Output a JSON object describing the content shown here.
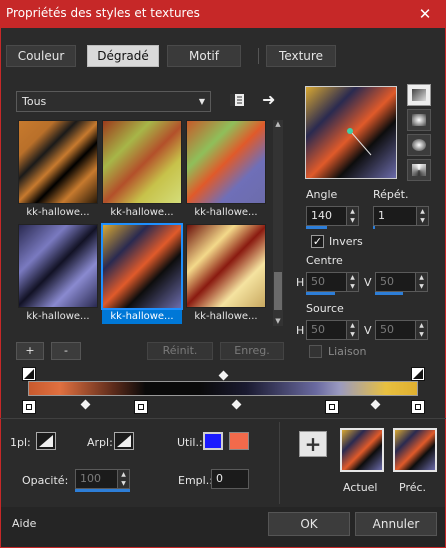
{
  "window": {
    "title": "Propriétés des styles et textures",
    "close_glyph": "✕"
  },
  "tabs": [
    {
      "label": "Couleur"
    },
    {
      "label": "Dégradé"
    },
    {
      "label": "Motif"
    },
    {
      "label": "Texture"
    }
  ],
  "category": {
    "selected": "Tous"
  },
  "thumbs": [
    {
      "label": "kk-hallowe..."
    },
    {
      "label": "kk-hallowe..."
    },
    {
      "label": "kk-hallowe..."
    },
    {
      "label": "kk-hallowe..."
    },
    {
      "label": "kk-hallowe..."
    },
    {
      "label": "kk-hallowe..."
    }
  ],
  "list_buttons": {
    "add": "+",
    "remove": "-",
    "reset": "Réinit.",
    "save": "Enreg."
  },
  "angle": {
    "label": "Angle",
    "value": "140",
    "fill": 0.39
  },
  "repeat": {
    "label": "Répét.",
    "value": "1",
    "fill": 0.03
  },
  "invert": {
    "label": "Invers",
    "checked": true
  },
  "center": {
    "label": "Centre",
    "h_label": "H",
    "h_value": "50",
    "v_label": "V",
    "v_value": "50"
  },
  "source": {
    "label": "Source",
    "h_label": "H",
    "h_value": "50",
    "v_label": "V",
    "v_value": "50"
  },
  "link": {
    "label": "Liaison",
    "checked": false
  },
  "bottom": {
    "first_label": "1pl:",
    "back_label": "Arpl:",
    "util_label": "Util.:",
    "util_color_1": "#1a1aff",
    "util_color_2": "#f26a4b",
    "opacity_label": "Opacité:",
    "opacity_value": "100",
    "empl_label": "Empl.:",
    "empl_value": "0",
    "plus": "+",
    "current_label": "Actuel",
    "previous_label": "Préc."
  },
  "footer": {
    "help": "Aide",
    "ok": "OK",
    "cancel": "Annuler"
  },
  "colors": {
    "accent": "#c62828",
    "selection": "#0078d7"
  }
}
